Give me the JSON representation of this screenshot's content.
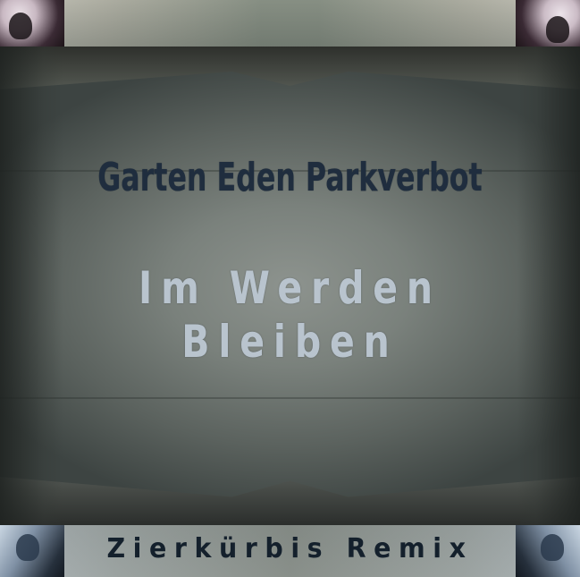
{
  "cover": {
    "artist": "Garten Eden Parkverbot",
    "title": "Im Werden Bleiben",
    "subtitle": "Zierkürbis Remix"
  },
  "colors": {
    "artist_text": "#1f2d3e",
    "title_text": "#b9c4ce",
    "subtitle_text": "#14202c",
    "photo_tone": "#7a817c"
  }
}
